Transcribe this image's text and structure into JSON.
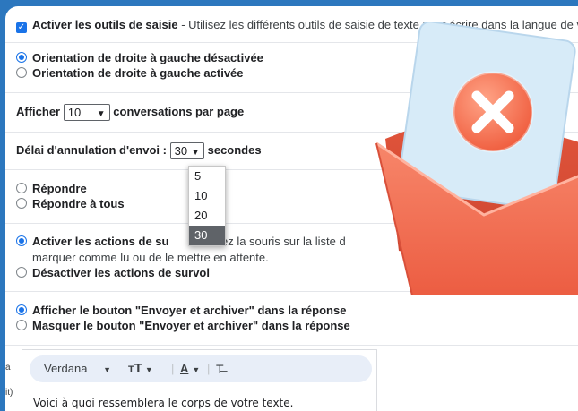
{
  "settings": {
    "input_tools": {
      "label": "Activer les outils de saisie",
      "description": " - Utilisez les différents outils de saisie de texte pour écrire dans la langue de votre choix"
    },
    "rtl": {
      "option_off": "Orientation de droite à gauche désactivée",
      "option_on": "Orientation de droite à gauche activée"
    },
    "page_size": {
      "prefix": "Afficher",
      "value": "10",
      "suffix": "conversations par page"
    },
    "undo_send": {
      "label": "Délai d'annulation d'envoi :",
      "value": "30",
      "suffix": "secondes",
      "options": [
        "5",
        "10",
        "20",
        "30"
      ]
    },
    "reply": {
      "option_reply": "Répondre",
      "option_reply_all": "Répondre à tous"
    },
    "hover": {
      "option_on_label": "Activer les actions de su",
      "option_on_desc": "Passez la souris sur la liste d",
      "option_on_desc2": "marquer comme lu ou de le mettre en attente.",
      "option_off": "Désactiver les actions de survol"
    },
    "send_archive": {
      "option_show": "Afficher le bouton \"Envoyer et archiver\" dans la réponse",
      "option_hide": "Masquer le bouton \"Envoyer et archiver\" dans la réponse"
    },
    "editor": {
      "font": "Verdana",
      "preview": "Voici à quoi ressemblera le corps de votre texte."
    },
    "left_edge": {
      "t1": "a",
      "t2": "it)"
    }
  },
  "colors": {
    "background": "#2c77be",
    "accent": "#1a73e8",
    "envelope": "#f26b4f",
    "letter": "#d7ebf8"
  },
  "icons": [
    "checkbox-checked-icon",
    "radio-icon",
    "chevron-down-icon",
    "font-size-icon",
    "text-color-icon",
    "clear-formatting-icon",
    "envelope-cancel-icon"
  ]
}
